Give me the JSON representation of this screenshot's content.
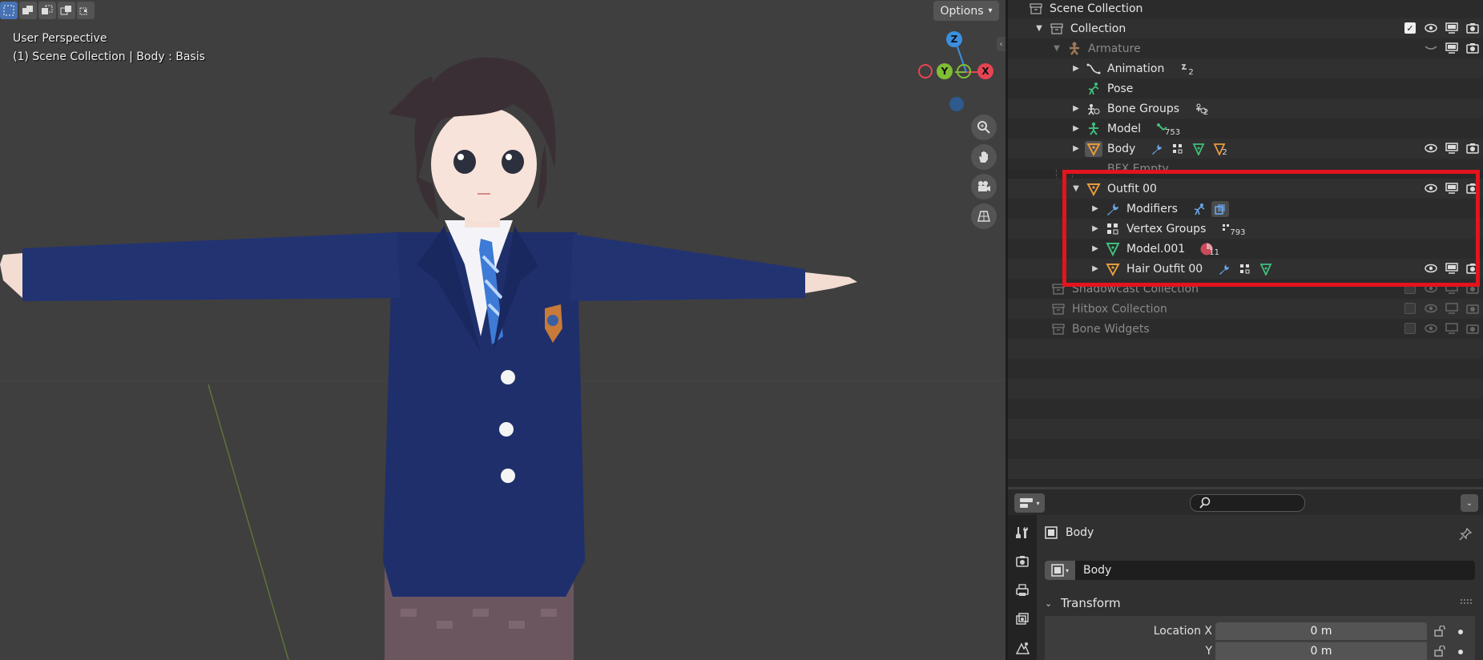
{
  "viewport": {
    "header_modes": [
      "select-box-icon",
      "extend-selection-icon",
      "subtract-selection-icon",
      "intersect-selection-icon"
    ],
    "perspective_label": "User Perspective",
    "context_label": "(1) Scene Collection | Body : Basis",
    "options_label": "Options",
    "gizmo": {
      "z": "Z",
      "y": "Y",
      "x": "X"
    }
  },
  "outliner": {
    "rows": [
      {
        "label": "Scene Collection"
      },
      {
        "label": "Collection"
      },
      {
        "label": "Armature"
      },
      {
        "label": "Animation",
        "sub_count": "",
        "sub_badge": "2"
      },
      {
        "label": "Pose"
      },
      {
        "label": "Bone Groups",
        "sub_badge": "2"
      },
      {
        "label": "Model",
        "sub_badge": "753"
      },
      {
        "label": "Body",
        "sub_badge": "2"
      },
      {
        "label": "BFX Empty"
      },
      {
        "label": "Outfit 00"
      },
      {
        "label": "Modifiers"
      },
      {
        "label": "Vertex Groups",
        "sub_badge": "793"
      },
      {
        "label": "Model.001",
        "sub_badge": "11"
      },
      {
        "label": "Hair Outfit 00"
      },
      {
        "label": "Shadowcast Collection"
      },
      {
        "label": "Hitbox Collection"
      },
      {
        "label": "Bone Widgets"
      }
    ]
  },
  "properties": {
    "search_placeholder": "",
    "context_object": "Body",
    "object_name": "Body",
    "panel_title": "Transform",
    "fields": [
      {
        "label": "Location X",
        "value": "0 m"
      },
      {
        "label": "Y",
        "value": "0 m"
      }
    ]
  },
  "colors": {
    "highlight_box": "#e3141e",
    "accent_blue": "#4772b3",
    "object_orange": "#e59b3c",
    "data_green": "#3fbf7a",
    "gizmo_x": "#e64454",
    "gizmo_y": "#7fbf34",
    "gizmo_z": "#3b8fe0"
  }
}
